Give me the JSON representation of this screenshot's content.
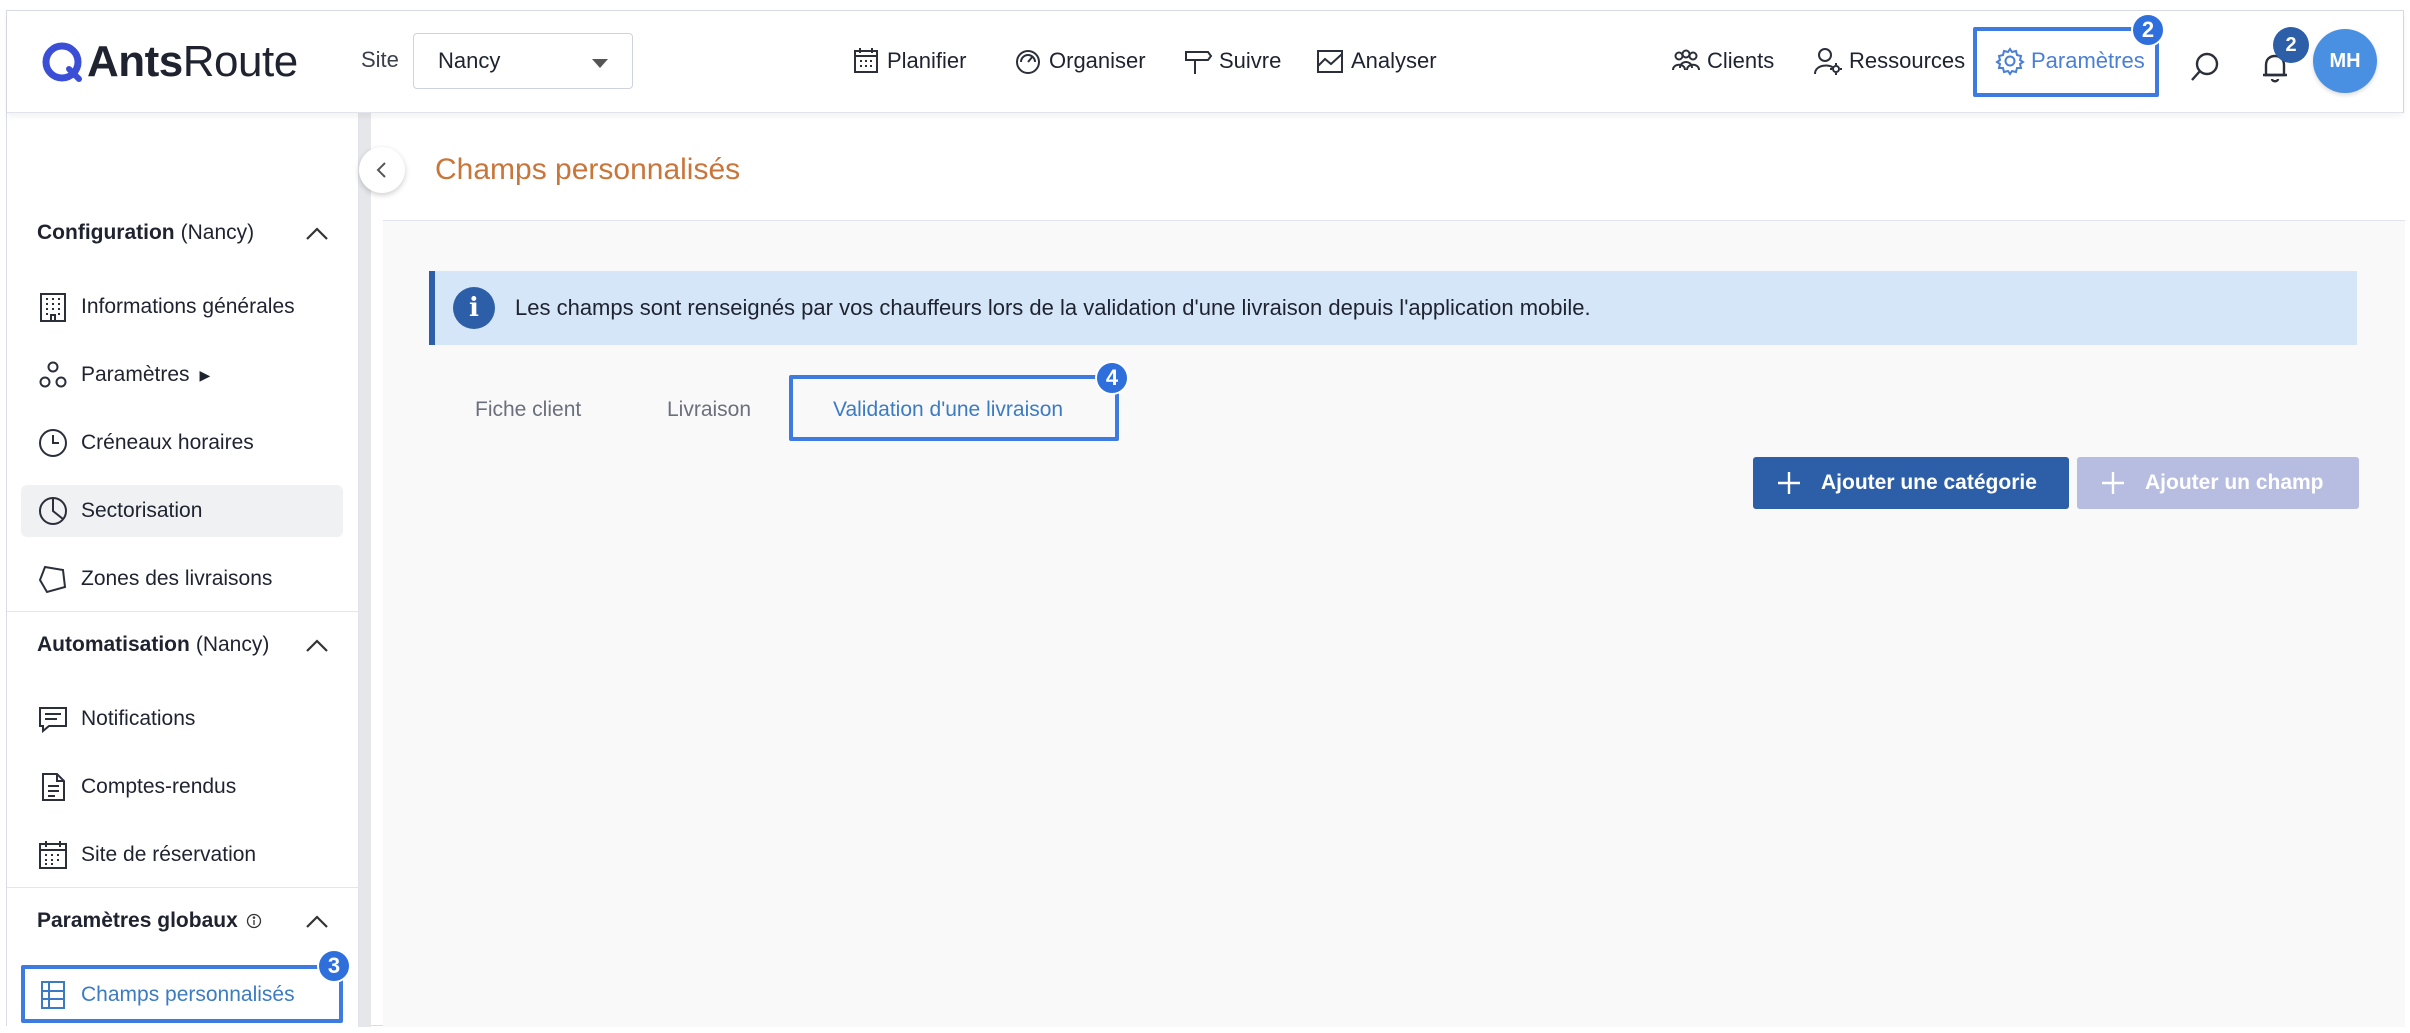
{
  "app": {
    "logo_bold": "Ants",
    "logo_light": "Route"
  },
  "topbar": {
    "site_label": "Site",
    "site_value": "Nancy",
    "nav": [
      {
        "label": "Planifier",
        "icon": "calendar-icon"
      },
      {
        "label": "Organiser",
        "icon": "gauge-icon"
      },
      {
        "label": "Suivre",
        "icon": "signpost-icon"
      },
      {
        "label": "Analyser",
        "icon": "chart-icon"
      }
    ],
    "right_nav": [
      {
        "label": "Clients",
        "icon": "people-icon"
      },
      {
        "label": "Ressources",
        "icon": "user-gear-icon"
      },
      {
        "label": "Paramètres",
        "icon": "gear-icon",
        "active": true
      }
    ],
    "notifications_count": "2",
    "avatar_initials": "MH"
  },
  "steps": {
    "params": "2",
    "sidebar": "3",
    "tab": "4"
  },
  "sidebar": {
    "sections": [
      {
        "title": "Configuration",
        "subtitle": "(Nancy)",
        "items": [
          {
            "label": "Informations générales",
            "icon": "building-icon"
          },
          {
            "label": "Paramètres",
            "icon": "settings-cluster-icon",
            "has_submenu": true
          },
          {
            "label": "Créneaux horaires",
            "icon": "clock-icon"
          },
          {
            "label": "Sectorisation",
            "icon": "pie-icon"
          },
          {
            "label": "Zones des livraisons",
            "icon": "polygon-icon"
          }
        ]
      },
      {
        "title": "Automatisation",
        "subtitle": "(Nancy)",
        "items": [
          {
            "label": "Notifications",
            "icon": "message-icon"
          },
          {
            "label": "Comptes-rendus",
            "icon": "document-icon"
          },
          {
            "label": "Site de réservation",
            "icon": "calendar-grid-icon"
          }
        ]
      },
      {
        "title": "Paramètres globaux",
        "subtitle": "",
        "items": [
          {
            "label": "Champs personnalisés",
            "icon": "form-fields-icon",
            "active": true
          }
        ]
      }
    ],
    "submenu_marker": "▶"
  },
  "main": {
    "title": "Champs personnalisés",
    "info": "Les champs sont renseignés par vos chauffeurs lors de la validation d'une livraison depuis l'application mobile.",
    "info_icon": "i",
    "tabs": [
      {
        "label": "Fiche client"
      },
      {
        "label": "Livraison"
      },
      {
        "label": "Validation d'une livraison",
        "active": true
      }
    ],
    "buttons": {
      "add_category": "Ajouter une catégorie",
      "add_field": "Ajouter un champ"
    }
  },
  "colors": {
    "primary": "#2d5fa8",
    "accent": "#4a7fd6",
    "highlight": "#3e7be0",
    "title": "#c8763a",
    "banner": "#d6e6f9"
  }
}
